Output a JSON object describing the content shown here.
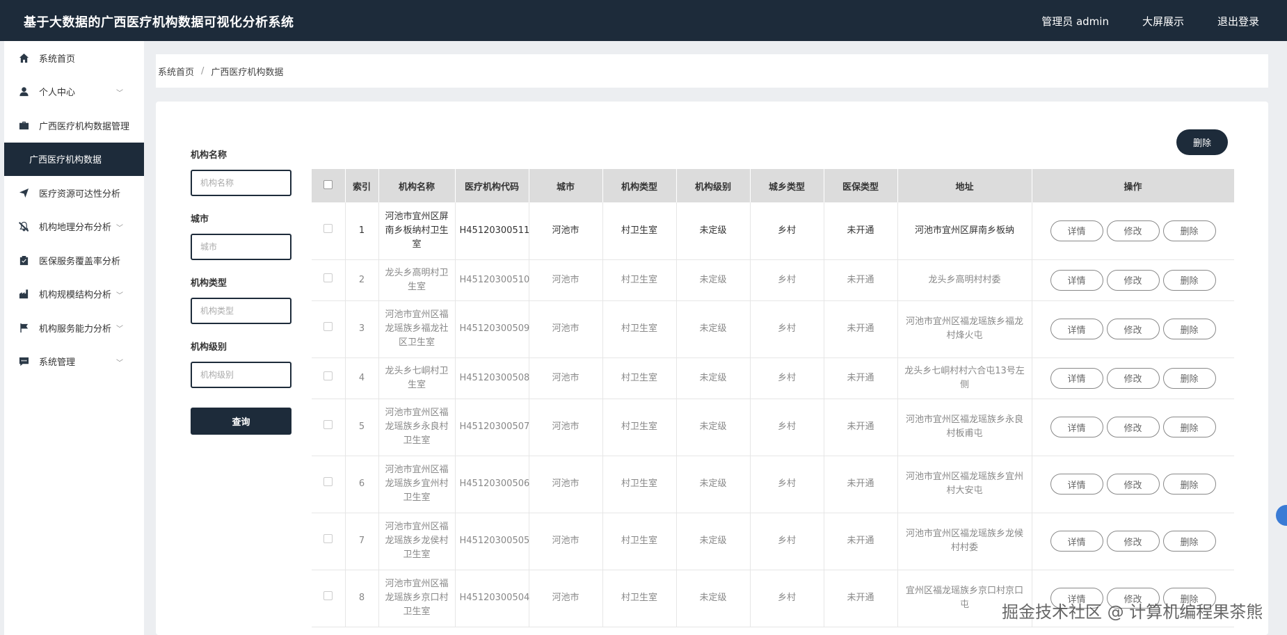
{
  "header": {
    "title": "基于大数据的广西医疗机构数据可视化分析系统",
    "nav": [
      "管理员 admin",
      "大屏展示",
      "退出登录"
    ]
  },
  "sidebar": {
    "items": [
      {
        "label": "系统首页",
        "icon": "home-icon"
      },
      {
        "label": "个人中心",
        "icon": "user-icon",
        "expand": true
      },
      {
        "label": "广西医疗机构数据管理",
        "icon": "briefcase-icon"
      },
      {
        "label": "广西医疗机构数据",
        "active": true
      },
      {
        "label": "医疗资源可达性分析",
        "icon": "send-icon"
      },
      {
        "label": "机构地理分布分析",
        "icon": "bell-off-icon",
        "expand": true
      },
      {
        "label": "医保服务覆盖率分析",
        "icon": "clipboard-icon"
      },
      {
        "label": "机构规模结构分析",
        "icon": "factory-icon",
        "expand": true
      },
      {
        "label": "机构服务能力分析",
        "icon": "flag-icon",
        "expand": true
      },
      {
        "label": "系统管理",
        "icon": "chat-icon",
        "expand": true
      }
    ]
  },
  "breadcrumb": {
    "home": "系统首页",
    "sep": "/",
    "current": "广西医疗机构数据"
  },
  "toolbar": {
    "delete_label": "删除"
  },
  "search": {
    "name_label": "机构名称",
    "name_placeholder": "机构名称",
    "city_label": "城市",
    "city_placeholder": "城市",
    "type_label": "机构类型",
    "type_placeholder": "机构类型",
    "level_label": "机构级别",
    "level_placeholder": "机构级别",
    "query_label": "查询"
  },
  "table": {
    "headers": [
      "索引",
      "机构名称",
      "医疗机构代码",
      "城市",
      "机构类型",
      "机构级别",
      "城乡类型",
      "医保类型",
      "地址",
      "操作"
    ],
    "ops": [
      "详情",
      "修改",
      "删除"
    ],
    "rows": [
      [
        "1",
        "河池市宜州区屏南乡板纳村卫生室",
        "H45120300511",
        "河池市",
        "村卫生室",
        "未定级",
        "乡村",
        "未开通",
        "河池市宜州区屏南乡板纳"
      ],
      [
        "2",
        "龙头乡高明村卫生室",
        "H45120300510",
        "河池市",
        "村卫生室",
        "未定级",
        "乡村",
        "未开通",
        "龙头乡高明村村委"
      ],
      [
        "3",
        "河池市宜州区福龙瑶族乡福龙社区卫生室",
        "H45120300509",
        "河池市",
        "村卫生室",
        "未定级",
        "乡村",
        "未开通",
        "河池市宜州区福龙瑶族乡福龙村烽火屯"
      ],
      [
        "4",
        "龙头乡七峒村卫生室",
        "H45120300508",
        "河池市",
        "村卫生室",
        "未定级",
        "乡村",
        "未开通",
        "龙头乡七峒村村六合屯13号左侧"
      ],
      [
        "5",
        "河池市宜州区福龙瑶族乡永良村卫生室",
        "H45120300507",
        "河池市",
        "村卫生室",
        "未定级",
        "乡村",
        "未开通",
        "河池市宜州区福龙瑶族乡永良村板甫屯"
      ],
      [
        "6",
        "河池市宜州区福龙瑶族乡宜州村卫生室",
        "H45120300506",
        "河池市",
        "村卫生室",
        "未定级",
        "乡村",
        "未开通",
        "河池市宜州区福龙瑶族乡宜州村大安屯"
      ],
      [
        "7",
        "河池市宜州区福龙瑶族乡龙侯村卫生室",
        "H45120300505",
        "河池市",
        "村卫生室",
        "未定级",
        "乡村",
        "未开通",
        "河池市宜州区福龙瑶族乡龙候村村委"
      ],
      [
        "8",
        "河池市宜州区福龙瑶族乡京口村卫生室",
        "H45120300504",
        "河池市",
        "村卫生室",
        "未定级",
        "乡村",
        "未开通",
        "宜州区福龙瑶族乡京口村京口屯"
      ]
    ]
  },
  "watermark": "掘金技术社区 @ 计算机编程果茶熊"
}
